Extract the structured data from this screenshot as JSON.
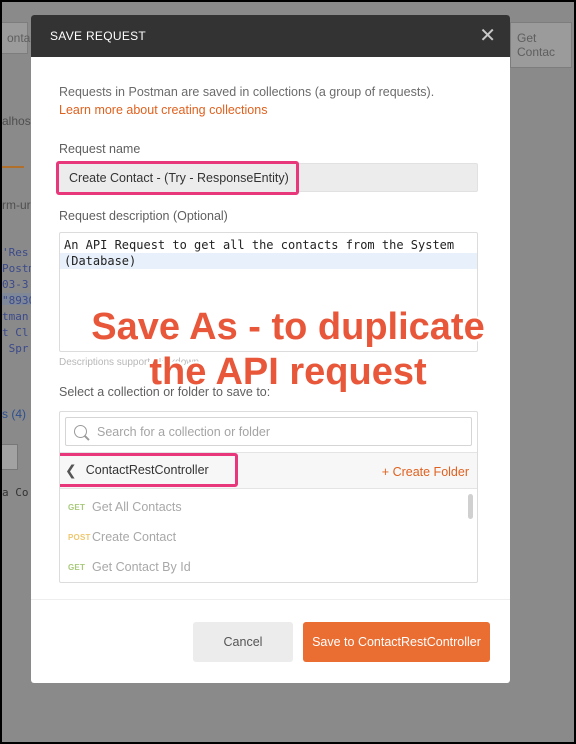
{
  "background": {
    "tab_left": "ontac",
    "tab_right": "Get Contac",
    "host_fragment": "alhos",
    "form_fragment": "rm-ur",
    "code_lines": [
      "'Res",
      "Postm",
      "03-3",
      "\"8930",
      "tman",
      "t Cl",
      " Spr"
    ],
    "tests_label": "s (4)",
    "bottom_fragment": "a Co"
  },
  "modal": {
    "title": "SAVE REQUEST",
    "close_icon": "close-icon",
    "intro_text": "Requests in Postman are saved in collections (a group of requests).",
    "learn_link": "Learn more about creating collections",
    "request_name_label": "Request name",
    "request_name_value": "Create Contact - (Try - ResponseEntity)",
    "description_label": "Request description (Optional)",
    "description_line1": "An API Request to get all the contacts from the System",
    "description_line2": "(Database)",
    "description_hint": "Descriptions support Markdown",
    "collection_label": "Select a collection or folder to save to:",
    "search_placeholder": "Search for a collection or folder",
    "current_folder": "ContactRestController",
    "create_folder": "+ Create Folder",
    "requests": [
      {
        "method": "GET",
        "name": "Get All Contacts"
      },
      {
        "method": "POST",
        "name": "Create Contact"
      },
      {
        "method": "GET",
        "name": "Get Contact By Id"
      }
    ],
    "cancel_label": "Cancel",
    "save_label": "Save to ContactRestController"
  },
  "annotation": {
    "line1": "Save As - to duplicate",
    "line2": "the API request"
  },
  "colors": {
    "accent": "#ea6d31",
    "highlight": "#e8377a",
    "annotation": "#e8573a",
    "header": "#333333"
  }
}
